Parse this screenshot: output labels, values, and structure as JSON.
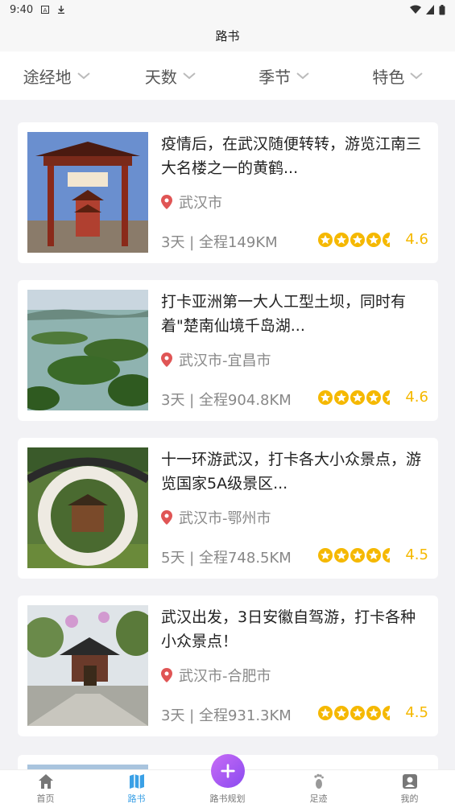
{
  "status_bar": {
    "time": "9:40"
  },
  "header": {
    "title": "路书"
  },
  "filters": [
    {
      "label": "途经地"
    },
    {
      "label": "天数"
    },
    {
      "label": "季节"
    },
    {
      "label": "特色"
    }
  ],
  "cards": [
    {
      "title": "疫情后，在武汉随便转转，游览江南三大名楼之一的黄鹤...",
      "location": "武汉市",
      "meta": "3天 | 全程149KM",
      "rating": "4.6"
    },
    {
      "title": "打卡亚洲第一大人工型土坝，同时有着\"楚南仙境千岛湖...",
      "location": "武汉市-宜昌市",
      "meta": "3天 | 全程904.8KM",
      "rating": "4.6"
    },
    {
      "title": "十一环游武汉，打卡各大小众景点，游览国家5A级景区...",
      "location": "武汉市-鄂州市",
      "meta": "5天 | 全程748.5KM",
      "rating": "4.5"
    },
    {
      "title": "武汉出发，3日安徽自驾游，打卡各种小众景点！",
      "location": "武汉市-合肥市",
      "meta": "3天 | 全程931.3KM",
      "rating": "4.5"
    }
  ],
  "tabs": [
    {
      "label": "首页",
      "icon": "home-icon"
    },
    {
      "label": "路书",
      "icon": "map-icon"
    },
    {
      "label": "路书规划",
      "icon": "plus-icon"
    },
    {
      "label": "足迹",
      "icon": "footprint-icon"
    },
    {
      "label": "我的",
      "icon": "user-icon"
    }
  ],
  "colors": {
    "accent": "#3aa0e6",
    "rating": "#f5b800",
    "location_pin": "#e05555",
    "fab_start": "#c86cf5",
    "fab_end": "#8a4af0"
  }
}
